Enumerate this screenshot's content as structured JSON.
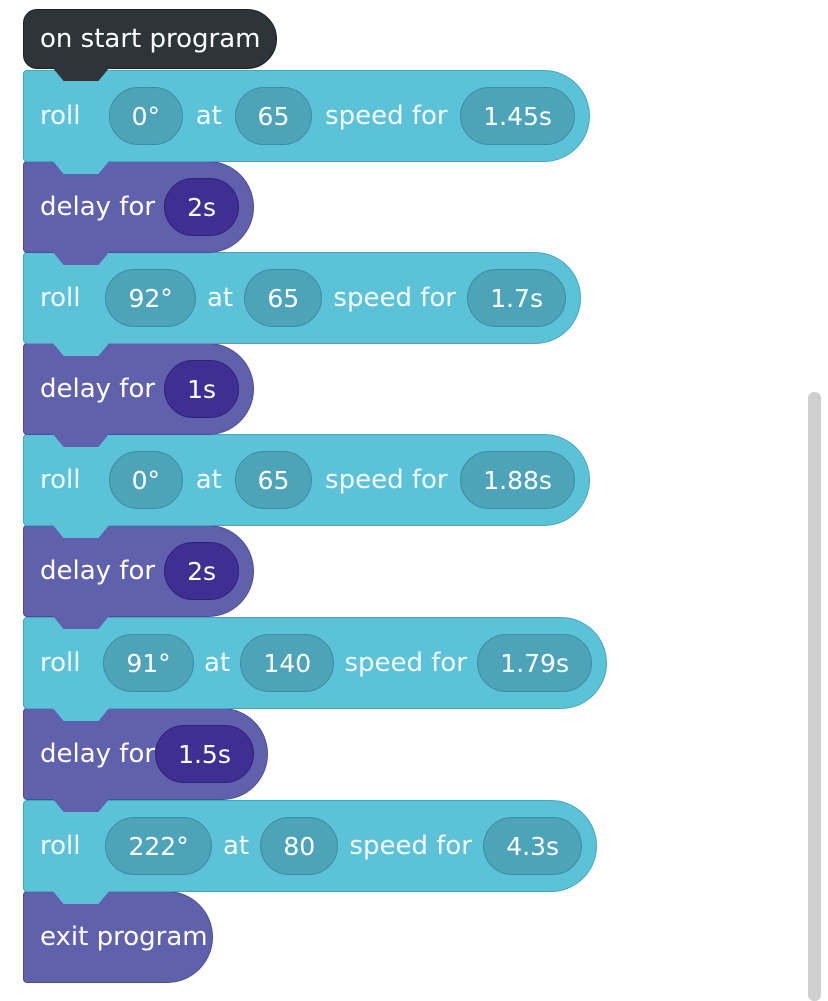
{
  "program": {
    "start_label": "on start program",
    "exit_label": "exit program",
    "blocks": [
      {
        "type": "roll",
        "label": "roll",
        "heading": "0°",
        "at_label": "at",
        "speed": "65",
        "speed_label": "speed for",
        "duration": "1.45s"
      },
      {
        "type": "delay",
        "label": "delay for",
        "duration": "2s"
      },
      {
        "type": "roll",
        "label": "roll",
        "heading": "92°",
        "at_label": "at",
        "speed": "65",
        "speed_label": "speed for",
        "duration": "1.7s"
      },
      {
        "type": "delay",
        "label": "delay for",
        "duration": "1s"
      },
      {
        "type": "roll",
        "label": "roll",
        "heading": "0°",
        "at_label": "at",
        "speed": "65",
        "speed_label": "speed for",
        "duration": "1.88s"
      },
      {
        "type": "delay",
        "label": "delay for",
        "duration": "2s"
      },
      {
        "type": "roll",
        "label": "roll",
        "heading": "91°",
        "at_label": "at",
        "speed": "140",
        "speed_label": "speed for",
        "duration": "1.79s"
      },
      {
        "type": "delay",
        "label": "delay for",
        "duration": "1.5s"
      },
      {
        "type": "roll",
        "label": "roll",
        "heading": "222°",
        "at_label": "at",
        "speed": "80",
        "speed_label": "speed for",
        "duration": "4.3s"
      }
    ]
  },
  "colors": {
    "start_block": "#2d3538",
    "roll_block": "#5cc2d8",
    "delay_block": "#6061ad",
    "exit_block": "#6061ad"
  }
}
